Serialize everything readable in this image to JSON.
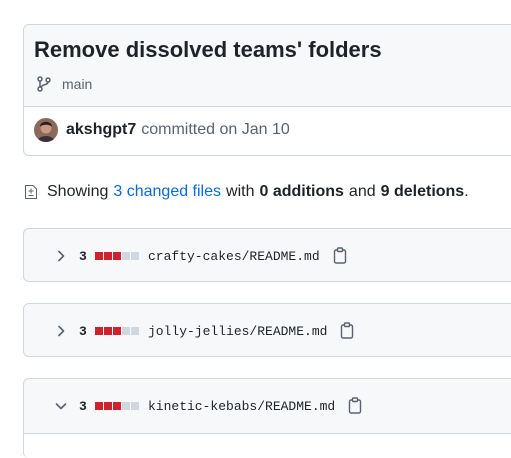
{
  "commit": {
    "title": "Remove dissolved teams' folders",
    "branch": "main",
    "author": "akshgpt7",
    "meta": "committed on Jan 10"
  },
  "summary": {
    "prefix": "Showing",
    "changed_files": "3 changed files",
    "with": "with",
    "additions": "0 additions",
    "and": "and",
    "deletions": "9 deletions",
    "suffix": "."
  },
  "files": [
    {
      "count": "3",
      "path": "crafty-cakes/README.md",
      "expanded": false,
      "deleted_blocks": 3,
      "total_blocks": 5
    },
    {
      "count": "3",
      "path": "jolly-jellies/README.md",
      "expanded": false,
      "deleted_blocks": 3,
      "total_blocks": 5
    },
    {
      "count": "3",
      "path": "kinetic-kebabs/README.md",
      "expanded": true,
      "deleted_blocks": 3,
      "total_blocks": 5
    }
  ],
  "icons": {
    "branch": "git-branch-icon",
    "file_diff": "file-diff-icon",
    "chevron_collapsed": "chevron-right-icon",
    "chevron_expanded": "chevron-down-icon",
    "copy": "copy-icon"
  },
  "colors": {
    "link": "#0969da",
    "deletion": "#cf222e",
    "neutral": "#d0d7de",
    "header_bg": "#f6f8fa"
  }
}
